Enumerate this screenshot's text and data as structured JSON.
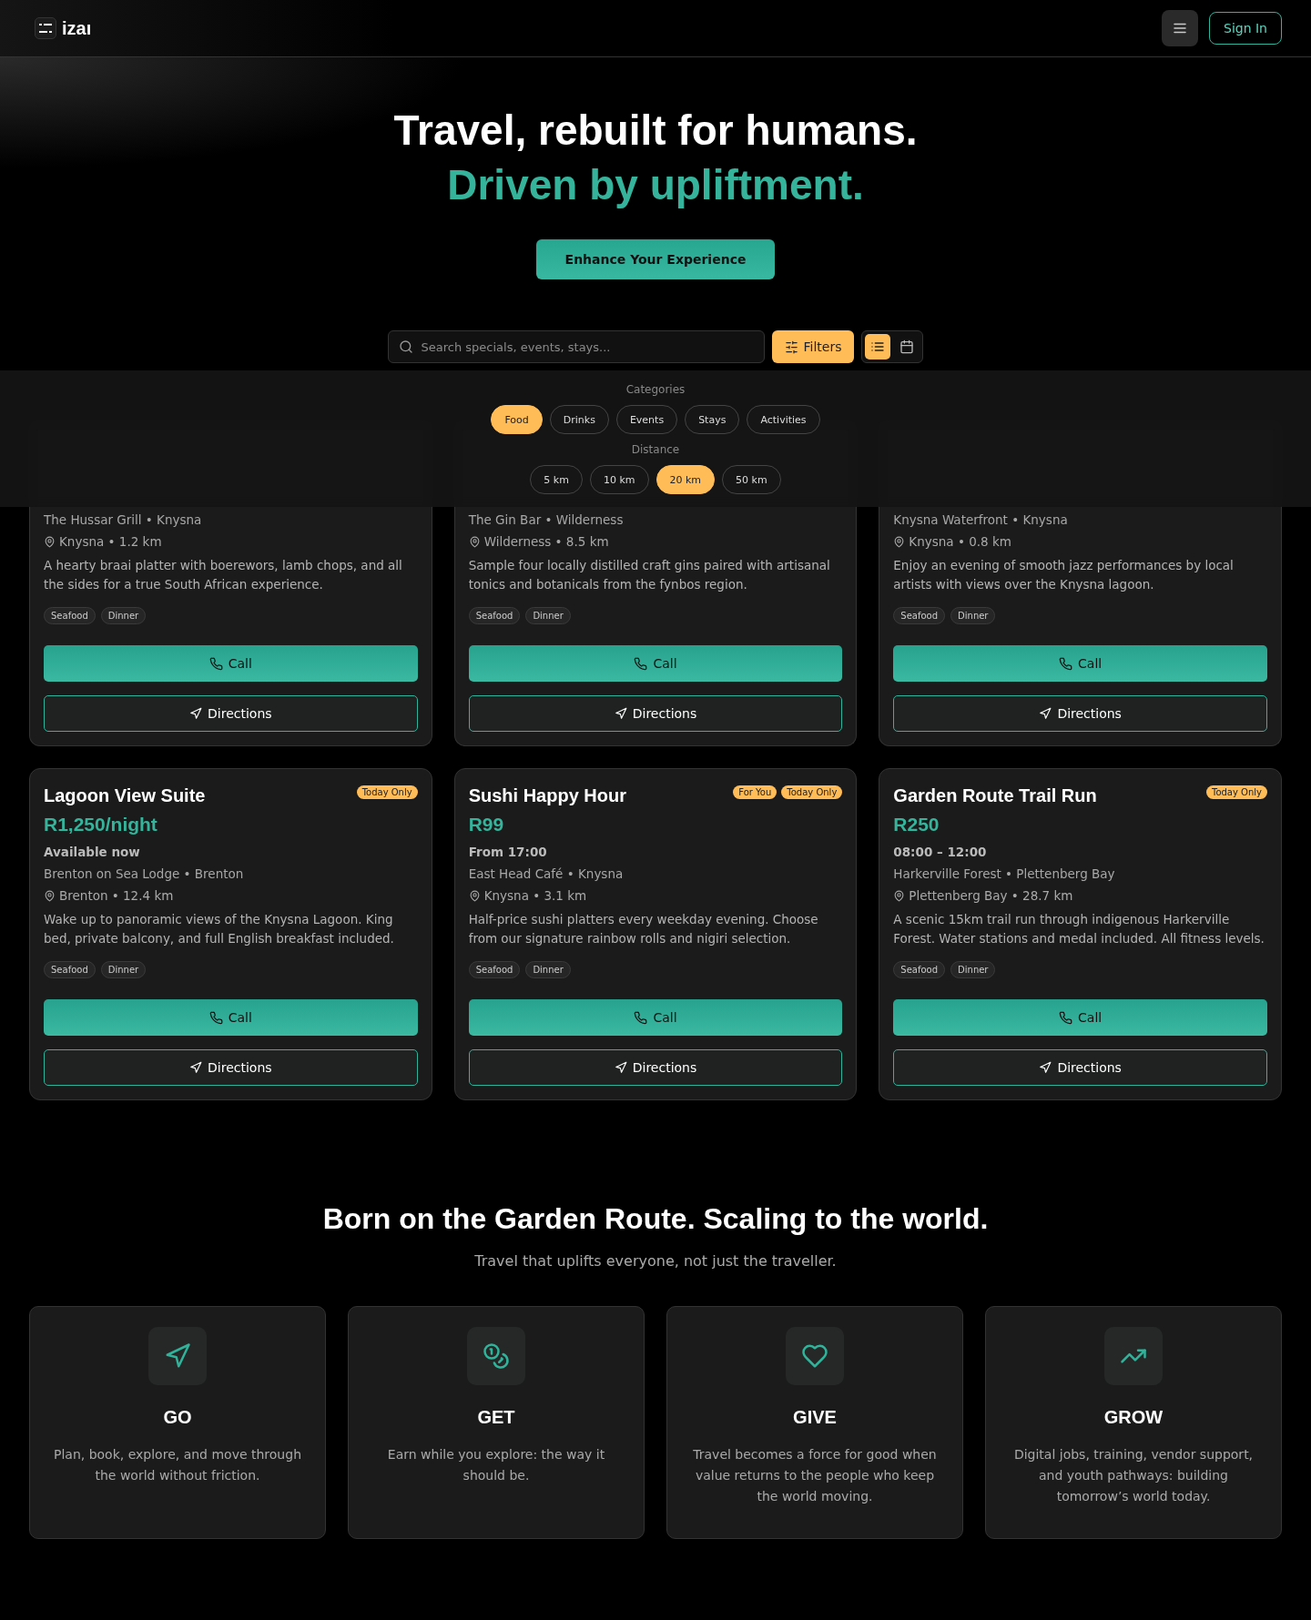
{
  "header": {
    "logo": "izaı",
    "sign_in": "Sign In"
  },
  "hero": {
    "title": "Travel, rebuilt for humans.",
    "subtitle": "Driven by upliftment.",
    "cta": "Enhance Your Experience"
  },
  "search": {
    "placeholder": "Search specials, events, stays...",
    "filters": "Filters",
    "views": [
      {
        "kind": "list",
        "selected": true
      },
      {
        "kind": "calendar",
        "selected": false
      }
    ]
  },
  "filter_panel": {
    "categories_label": "Categories",
    "categories": [
      {
        "label": "Food",
        "selected": true
      },
      {
        "label": "Drinks",
        "selected": false
      },
      {
        "label": "Events",
        "selected": false
      },
      {
        "label": "Stays",
        "selected": false
      },
      {
        "label": "Activities",
        "selected": false
      }
    ],
    "distance_label": "Distance",
    "distances": [
      {
        "label": "5 km",
        "selected": false
      },
      {
        "label": "10 km",
        "selected": false
      },
      {
        "label": "20 km",
        "selected": true
      },
      {
        "label": "50 km",
        "selected": false
      }
    ]
  },
  "cards_hidden_top": [
    {
      "venue": "The Hussar Grill • Knysna",
      "location": "Knysna • 1.2 km",
      "description": "A hearty braai platter with boerewors, lamb chops, and all the sides for a true South African experience.",
      "tags": [
        "Seafood",
        "Dinner"
      ],
      "call": "Call",
      "directions": "Directions"
    },
    {
      "venue": "The Gin Bar • Wilderness",
      "location": "Wilderness • 8.5 km",
      "description": "Sample four locally distilled craft gins paired with artisanal tonics and botanicals from the fynbos region.",
      "tags": [
        "Seafood",
        "Dinner"
      ],
      "call": "Call",
      "directions": "Directions"
    },
    {
      "venue": "Knysna Waterfront • Knysna",
      "location": "Knysna • 0.8 km",
      "description": "Enjoy an evening of smooth jazz performances by local artists with views over the Knysna lagoon.",
      "tags": [
        "Seafood",
        "Dinner"
      ],
      "call": "Call",
      "directions": "Directions"
    }
  ],
  "cards": [
    {
      "title": "Lagoon View Suite",
      "badges": [
        "Today Only"
      ],
      "price": "R1,250/night",
      "time": "Available now",
      "venue": "Brenton on Sea Lodge • Brenton",
      "location": "Brenton • 12.4 km",
      "description": "Wake up to panoramic views of the Knysna Lagoon. King bed, private balcony, and full English breakfast included.",
      "tags": [
        "Seafood",
        "Dinner"
      ],
      "call": "Call",
      "directions": "Directions"
    },
    {
      "title": "Sushi Happy Hour",
      "badges": [
        "For You",
        "Today Only"
      ],
      "price": "R99",
      "time": "From 17:00",
      "venue": "East Head Café • Knysna",
      "location": "Knysna • 3.1 km",
      "description": "Half-price sushi platters every weekday evening. Choose from our signature rainbow rolls and nigiri selection.",
      "tags": [
        "Seafood",
        "Dinner"
      ],
      "call": "Call",
      "directions": "Directions"
    },
    {
      "title": "Garden Route Trail Run",
      "badges": [
        "Today Only"
      ],
      "price": "R250",
      "time": "08:00 – 12:00",
      "venue": "Harkerville Forest • Plettenberg Bay",
      "location": "Plettenberg Bay • 28.7 km",
      "description": "A scenic 15km trail run through indigenous Harkerville Forest. Water stations and medal included. All fitness levels.",
      "tags": [
        "Seafood",
        "Dinner"
      ],
      "call": "Call",
      "directions": "Directions"
    }
  ],
  "about": {
    "title": "Born on the Garden Route. Scaling to the world.",
    "subtitle": "Travel that uplifts everyone, not just the traveller.",
    "pillars": [
      {
        "kind": "go",
        "title": "GO",
        "text": "Plan, book, explore, and move through the world without friction."
      },
      {
        "kind": "get",
        "title": "GET",
        "text": "Earn while you explore: the way it should be."
      },
      {
        "kind": "give",
        "title": "GIVE",
        "text": "Travel becomes a force for good when value returns to the people who keep the world moving."
      },
      {
        "kind": "grow",
        "title": "GROW",
        "text": "Digital jobs, training, vendor support, and youth pathways: building tomorrow’s world today."
      }
    ]
  }
}
